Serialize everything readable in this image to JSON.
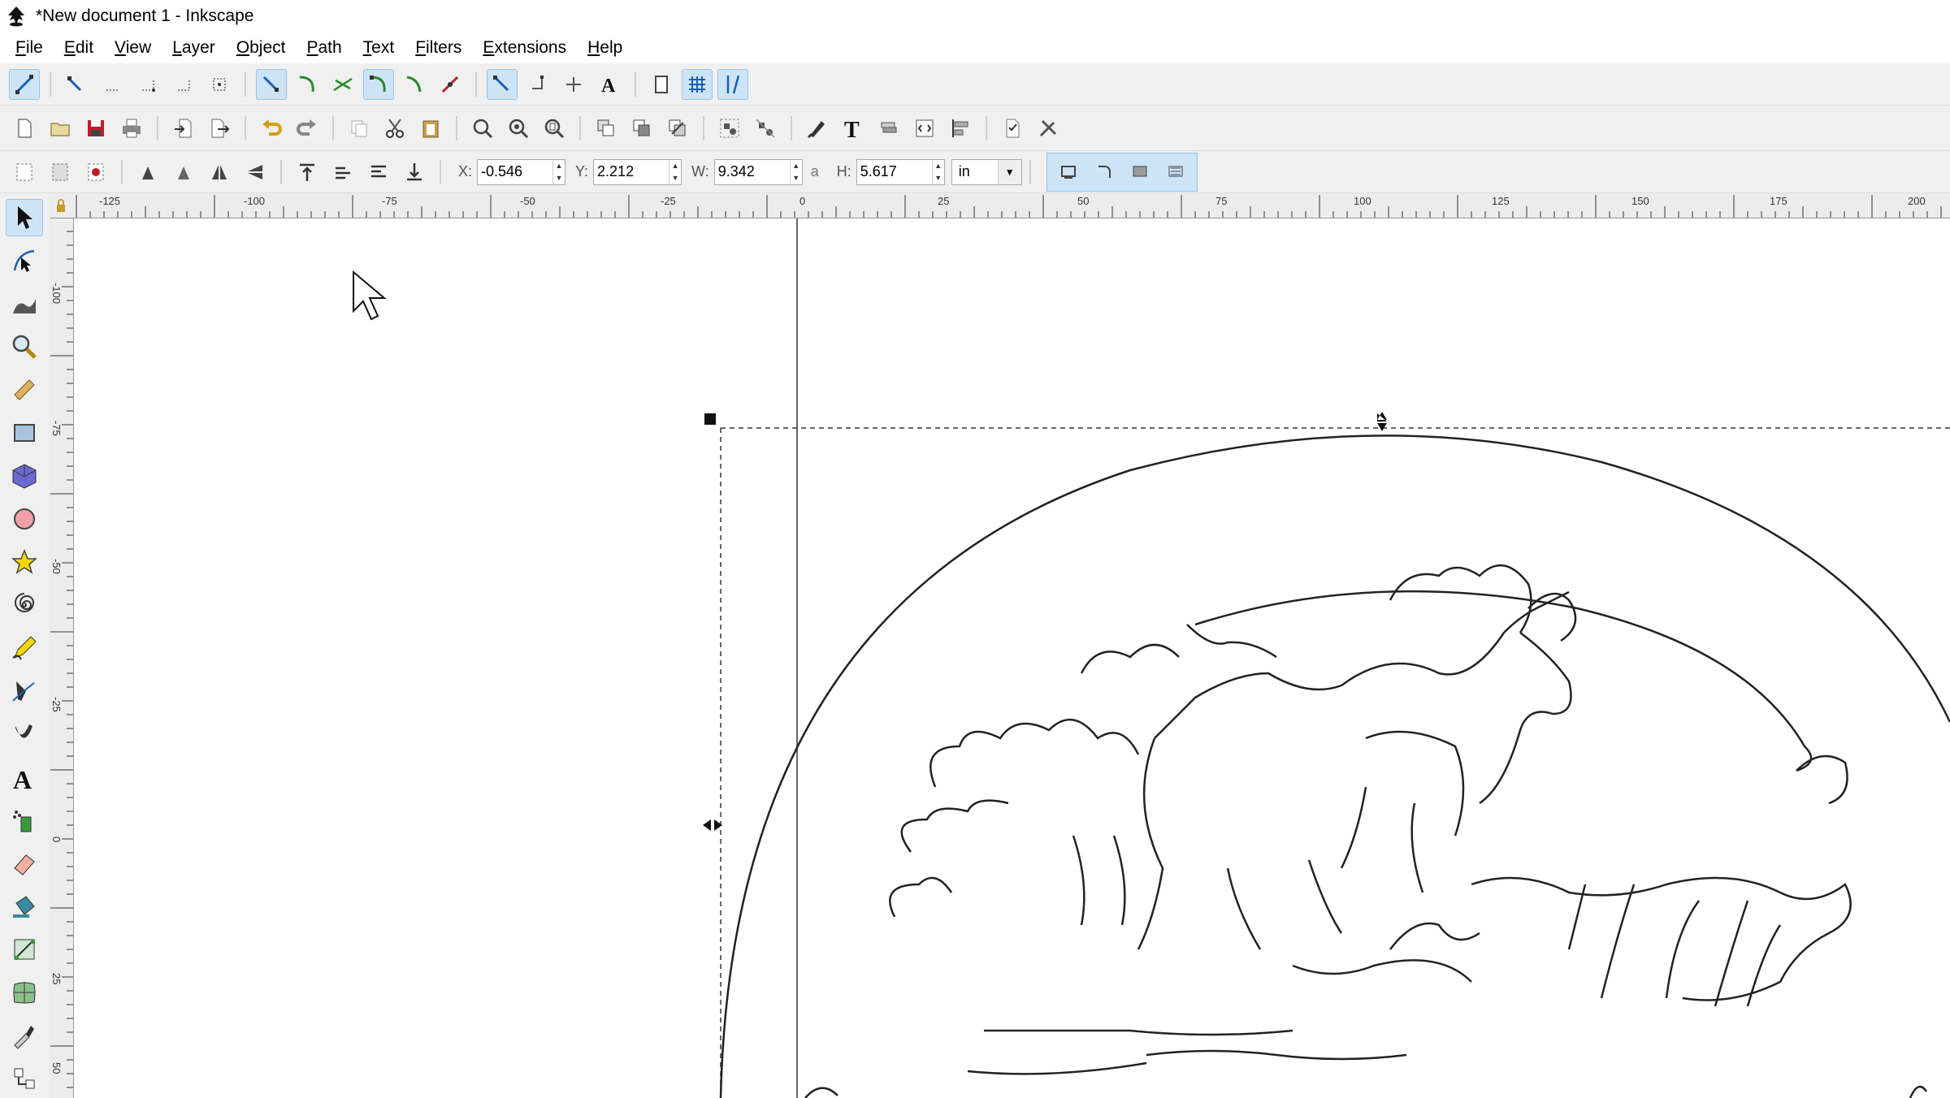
{
  "window": {
    "title": "*New document 1 - Inkscape"
  },
  "menubar": {
    "items": [
      "File",
      "Edit",
      "View",
      "Layer",
      "Object",
      "Path",
      "Text",
      "Filters",
      "Extensions",
      "Help"
    ]
  },
  "snap_toolbar": {
    "icons": [
      "snap-toggle-icon",
      "snap-bbox-icon",
      "snap-bbox-edge-icon",
      "snap-bbox-corner-icon",
      "snap-bbox-midpoint-icon",
      "snap-bbox-center-icon",
      "snap-nodes-icon",
      "snap-paths-icon",
      "snap-intersections-icon",
      "snap-cusp-nodes-icon",
      "snap-smooth-nodes-icon",
      "snap-line-midpoints-icon",
      "snap-others-icon",
      "snap-object-centers-icon",
      "snap-rotation-center-icon",
      "snap-text-baseline-icon",
      "snap-page-border-icon",
      "snap-grids-icon",
      "snap-guides-icon"
    ]
  },
  "commands_toolbar": {
    "icons": [
      "new-document-icon",
      "open-icon",
      "save-icon",
      "print-icon",
      "import-icon",
      "export-icon",
      "undo-icon",
      "redo-icon",
      "copy-icon",
      "cut-icon",
      "paste-icon",
      "zoom-selection-icon",
      "zoom-drawing-icon",
      "zoom-page-icon",
      "duplicate-icon",
      "clone-icon",
      "unlink-clone-icon",
      "group-icon",
      "ungroup-icon",
      "fill-stroke-icon",
      "text-font-icon",
      "layers-icon",
      "xml-editor-icon",
      "align-distribute-icon",
      "document-properties-icon",
      "preferences-icon"
    ]
  },
  "select_toolbar": {
    "x_label": "X:",
    "x_value": "-0.546",
    "y_label": "Y:",
    "y_value": "2.212",
    "w_label": "W:",
    "w_value": "9.342",
    "lock_symbol": "a",
    "h_label": "H:",
    "h_value": "5.617",
    "unit": "in"
  },
  "tools": [
    "selector-tool-icon",
    "node-tool-icon",
    "tweak-tool-icon",
    "zoom-tool-icon",
    "measure-tool-icon",
    "rect-tool-icon",
    "3dbox-tool-icon",
    "ellipse-tool-icon",
    "star-tool-icon",
    "spiral-tool-icon",
    "pencil-tool-icon",
    "pen-tool-icon",
    "calligraphy-tool-icon",
    "text-tool-icon",
    "spray-tool-icon",
    "eraser-tool-icon",
    "paint-bucket-tool-icon",
    "gradient-tool-icon",
    "mesh-tool-icon",
    "dropper-tool-icon",
    "connector-tool-icon"
  ],
  "rulers": {
    "h_labels": [
      "-125",
      "-100",
      "-75",
      "-50",
      "-25",
      "0",
      "25",
      "50",
      "75",
      "100",
      "125",
      "150",
      "175",
      "200"
    ],
    "v_labels": [
      "-100",
      "-75",
      "-50",
      "-25",
      "0",
      "25",
      "50"
    ]
  },
  "colors": {
    "accent": "#cde4f7",
    "accent_border": "#99c3ea",
    "stroke": "#222222"
  }
}
